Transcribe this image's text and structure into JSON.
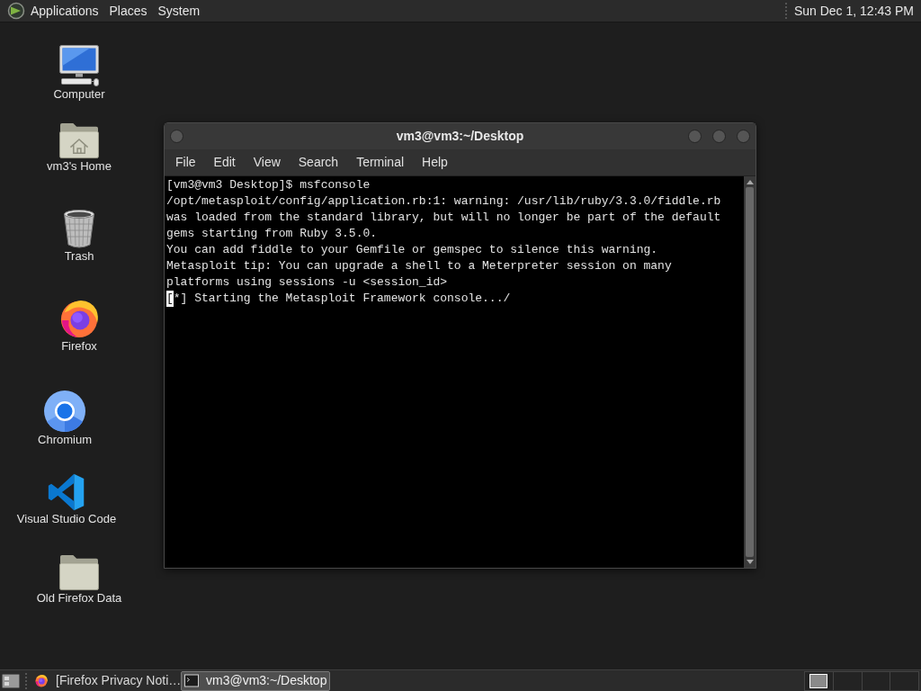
{
  "top_panel": {
    "menus": [
      "Applications",
      "Places",
      "System"
    ],
    "clock": "Sun Dec 1, 12:43 PM"
  },
  "desktop_icons": [
    {
      "kind": "computer",
      "label": "Computer"
    },
    {
      "kind": "home",
      "label": "vm3's Home"
    },
    {
      "kind": "trash",
      "label": "Trash"
    },
    {
      "kind": "firefox",
      "label": "Firefox"
    },
    {
      "kind": "chromium",
      "label": "Chromium"
    },
    {
      "kind": "vscode",
      "label": "Visual Studio Code"
    },
    {
      "kind": "folder",
      "label": "Old Firefox Data"
    }
  ],
  "terminal_window": {
    "title": "vm3@vm3:~/Desktop",
    "menu": [
      "File",
      "Edit",
      "View",
      "Search",
      "Terminal",
      "Help"
    ],
    "lines": [
      {
        "text": "[vm3@vm3 Desktop]$ msfconsole",
        "cursor": false
      },
      {
        "text": "/opt/metasploit/config/application.rb:1: warning: /usr/lib/ruby/3.3.0/fiddle.rb",
        "cursor": false
      },
      {
        "text": "was loaded from the standard library, but will no longer be part of the default",
        "cursor": false
      },
      {
        "text": "gems starting from Ruby 3.5.0.",
        "cursor": false
      },
      {
        "text": "You can add fiddle to your Gemfile or gemspec to silence this warning.",
        "cursor": false
      },
      {
        "text": "Metasploit tip: You can upgrade a shell to a Meterpreter session on many",
        "cursor": false
      },
      {
        "text": "platforms using sessions -u <session_id>",
        "cursor": false
      },
      {
        "text": "[*] Starting the Metasploit Framework console.../",
        "cursor": true
      }
    ]
  },
  "taskbar": {
    "tasks": [
      {
        "kind": "firefox",
        "label": "[Firefox Privacy Noti…",
        "selected": false
      },
      {
        "kind": "terminal",
        "label": "vm3@vm3:~/Desktop",
        "selected": true
      }
    ]
  }
}
